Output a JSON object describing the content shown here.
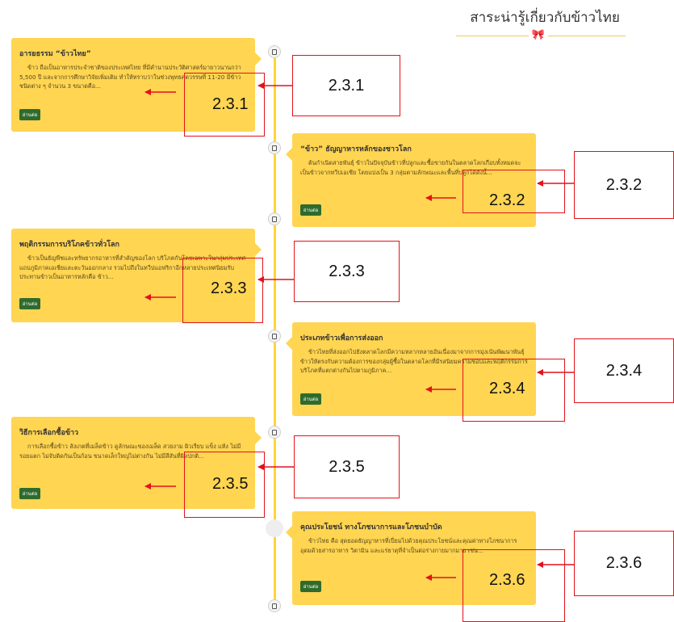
{
  "header": {
    "title": "สาระน่ารู้เกี่ยวกับข้าวไทย",
    "ornament": "ribbon-bow-icon"
  },
  "colors": {
    "card": "#ffd552",
    "timeline": "#ffd43a",
    "button": "#2f6b2c",
    "annotation": "#e3121b"
  },
  "read_more_label": "อ่านต่อ",
  "cards": [
    {
      "title": "อารยธรรม “ข้าวไทย”",
      "text": "ข้าว ถือเป็นอาหารประจำชาติของประเทศไทย ที่มีคำนานประวัติศาสตร์มายาวนานกว่า 5,500 ปี และจากการศึกษาวิจัยเพิ่มเติม ทำให้ทราบว่าในช่วงพุทธศตวรรษที่ 11-20 มีข้าวชนิดต่าง ๆ จำนวน 3 ขนาดคือ..."
    },
    {
      "title": "“ข้าว” ธัญญาหารหลักของชาวโลก",
      "text": "ต้นกำเนิดสายพันธุ์ ข้าวในปัจจุบันข้าวที่ปลูกและซื้อขายกันในตลาดโลกเกือบทั้งหมดจะเป็นข้าวจากทวีปเอเชีย โดยแบ่งเป็น 3 กลุ่มตามลักษณะและพื้นที่ปลูกได้ดังนี้..."
    },
    {
      "title": "พฤติกรรมการบริโภคข้าวทั่วโลก",
      "text": "ข้าวเป็นธัญพืชและทรัพยากรอาหารที่สำคัญของโลก บริโภคกันโดยเฉพาะในกลุ่มประเทศแถบภูมิภาคเอเชียและตะวันออกกลาง รวมไปถึงในทวีปแอฟริกาอีกหลายประเทศนิยมรับประทานข้าวเป็นอาหารหลักคือ ข้าว..."
    },
    {
      "title": "ประเภทข้าวเพื่อการส่งออก",
      "text": "ข้าวไทยที่ส่งออกไปยังตลาดโลกมีความหลากหลายอันเนื่องมาจากการมุ่งเน้นพัฒนาพันธุ์ข้าวให้ตรงกับความต้องการของกลุ่มผู้ซื้อในตลาดโลกที่มีรสนิยมความชอบและพฤติกรรมการบริโภคที่แตกต่างกันไปตามภูมิภาค..."
    },
    {
      "title": "วิธีการเลือกซื้อข้าว",
      "text": "การเลือกซื้อข้าว สังเกตที่เมล็ดข้าว ดูลักษณะของเมล็ด สวยงาม ผิวเรียบ แข็ง แห้ง ไม่มีรอยแตก ไม่จับติดกันเป็นก้อน ขนาดเล็กใหญ่ไม่ต่างกัน ไม่มีสีสันที่ผิดปกติ..."
    },
    {
      "title": "คุณประโยชน์ ทางโภชนาการและโภชนบำบัด",
      "text": "ข้าวไทย คือ สุดยอดธัญญาหารที่เปี่ยมไปด้วยคุณประโยชน์และคุณค่าทางโภชนาการ อุดมด้วยสารอาหาร วิตามิน และแร่ธาตุที่จำเป็นต่อร่างกายมากมาย เช่น..."
    }
  ],
  "annotations": [
    "2.3.1",
    "2.3.2",
    "2.3.3",
    "2.3.4",
    "2.3.5",
    "2.3.6"
  ]
}
